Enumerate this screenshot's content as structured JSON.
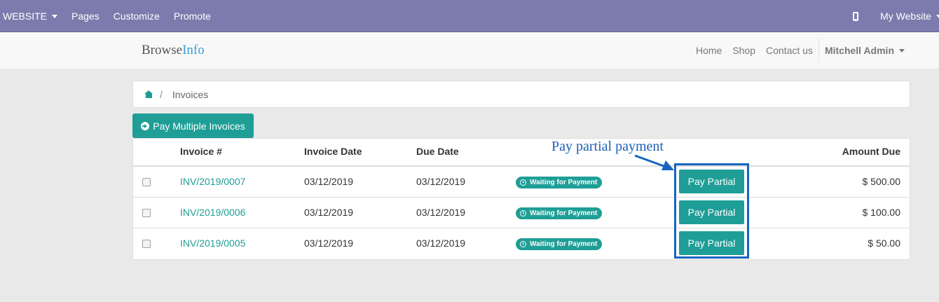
{
  "admin_bar": {
    "menu": [
      {
        "label": "WEBSITE",
        "has_caret": true
      },
      {
        "label": "Pages",
        "has_caret": false
      },
      {
        "label": "Customize",
        "has_caret": false
      },
      {
        "label": "Promote",
        "has_caret": false
      }
    ],
    "mobile_icon": "mobile-phone-icon",
    "website_switch": "My Website"
  },
  "header": {
    "brand_part1": "Browse",
    "brand_part2": "Info",
    "nav": [
      "Home",
      "Shop",
      "Contact us"
    ],
    "user": "Mitchell Admin",
    "brand_accent_color": "#3b9fd6"
  },
  "breadcrumb": {
    "home_icon": "home-icon",
    "separator": "/",
    "current": "Invoices"
  },
  "actions": {
    "pay_multiple": "Pay Multiple Invoices"
  },
  "table": {
    "headers": {
      "invoice": "Invoice #",
      "invoice_date": "Invoice Date",
      "due_date": "Due Date",
      "amount_due": "Amount Due"
    },
    "rows": [
      {
        "invoice": "INV/2019/0007",
        "invoice_date": "03/12/2019",
        "due_date": "03/12/2019",
        "status": "Waiting for Payment",
        "action": "Pay Partial",
        "amount": "$ 500.00"
      },
      {
        "invoice": "INV/2019/0006",
        "invoice_date": "03/12/2019",
        "due_date": "03/12/2019",
        "status": "Waiting for Payment",
        "action": "Pay Partial",
        "amount": "$ 100.00"
      },
      {
        "invoice": "INV/2019/0005",
        "invoice_date": "03/12/2019",
        "due_date": "03/12/2019",
        "status": "Waiting for Payment",
        "action": "Pay Partial",
        "amount": "$ 50.00"
      }
    ]
  },
  "annotation": {
    "text": "Pay partial payment",
    "color": "#1565c0"
  },
  "colors": {
    "admin_bar": "#7c7bad",
    "primary": "#1e9e96"
  }
}
